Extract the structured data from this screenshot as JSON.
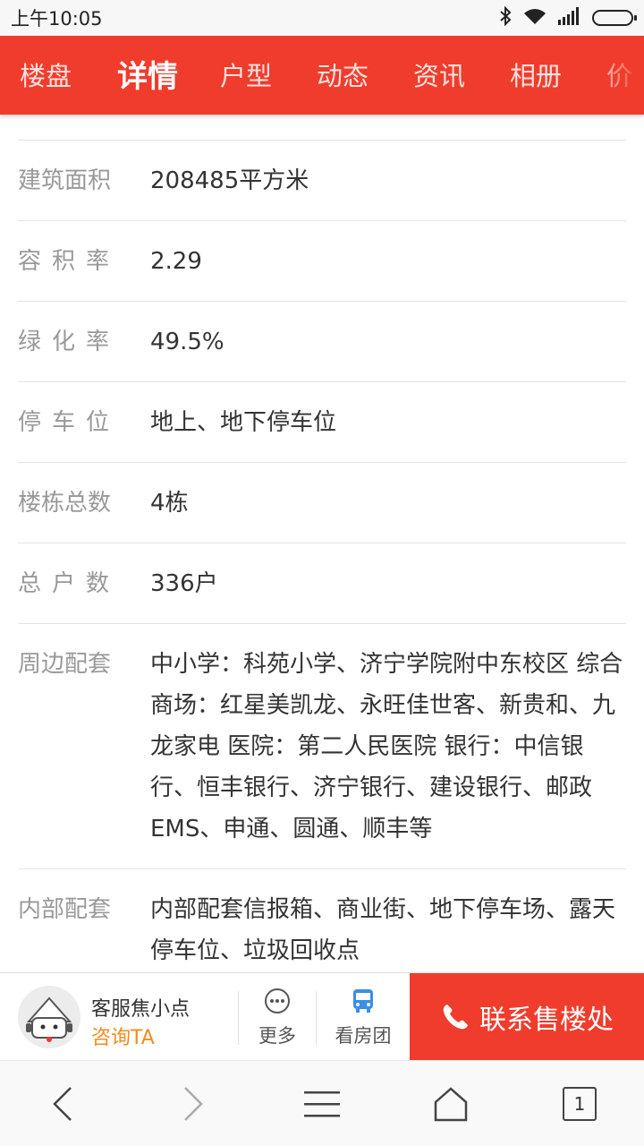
{
  "status_bar": {
    "time": "上午10:05",
    "icons": [
      "bluetooth-icon",
      "wifi-icon",
      "signal-icon",
      "battery-icon"
    ]
  },
  "tabs": [
    {
      "label": "楼盘",
      "active": false
    },
    {
      "label": "详情",
      "active": true
    },
    {
      "label": "户型",
      "active": false
    },
    {
      "label": "动态",
      "active": false
    },
    {
      "label": "资讯",
      "active": false
    },
    {
      "label": "相册",
      "active": false
    },
    {
      "label": "价",
      "active": false
    }
  ],
  "details": [
    {
      "label": "建筑面积",
      "value": "208485平方米"
    },
    {
      "label": "容积率",
      "value": "2.29"
    },
    {
      "label": "绿化率",
      "value": "49.5%"
    },
    {
      "label": "停车位",
      "value": "地上、地下停车位"
    },
    {
      "label": "楼栋总数",
      "value": "4栋"
    },
    {
      "label": "总户数",
      "value": "336户"
    },
    {
      "label": "周边配套",
      "value": "中小学：科苑小学、济宁学院附中东校区 综合商场：红星美凯龙、永旺佳世客、新贵和、九龙家电 医院：第二人民医院 银行：中信银行、恒丰银行、济宁银行、建设银行、邮政EMS、申通、圆通、顺丰等"
    },
    {
      "label": "内部配套",
      "value": "内部配套信报箱、商业街、地下停车场、露天停车位、垃圾回收点"
    }
  ],
  "action_bar": {
    "agent_name": "客服焦小点",
    "ask_label": "咨询TA",
    "more_label": "更多",
    "tour_label": "看房团",
    "contact_label": "联系售楼处"
  },
  "nav_bar": {
    "tab_count": "1"
  },
  "colors": {
    "brand_red": "#f03c2c",
    "ask_orange": "#f08c1e",
    "tour_blue": "#3a8ee6"
  }
}
